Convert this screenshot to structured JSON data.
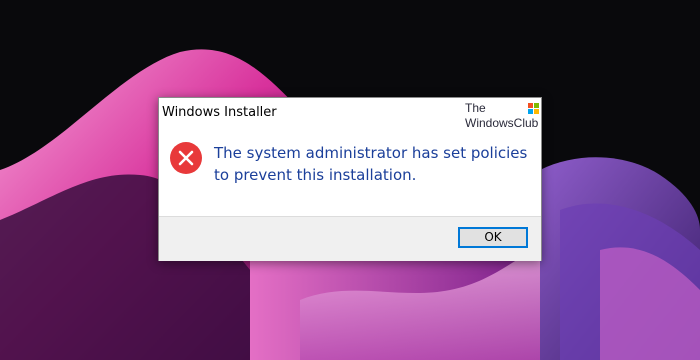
{
  "dialog": {
    "title": "Windows Installer",
    "message_line1": "The system administrator has set policies",
    "message_line2": "to prevent this installation.",
    "icon": "error-icon",
    "ok_label": "OK"
  },
  "watermark": {
    "line1": "The",
    "line2": "WindowsClub",
    "icon": "windows-logo-icon"
  },
  "colors": {
    "message_text": "#1b3f9a",
    "error_icon": "#e8393a",
    "button_border": "#0078d7",
    "footer_bg": "#f0f0f0"
  }
}
